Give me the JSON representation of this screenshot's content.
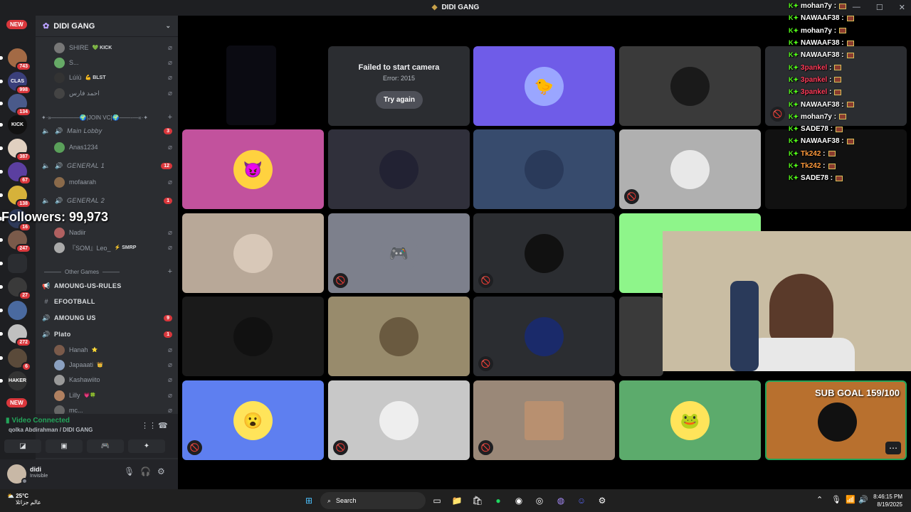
{
  "window": {
    "title": "DIDI GANG"
  },
  "server_rail": {
    "new_top": "NEW",
    "new_bottom": "NEW",
    "servers": [
      {
        "label": "",
        "badge": "743",
        "color": "#a36a45"
      },
      {
        "label": "CLAS",
        "badge": "998",
        "color": "#3a3f7a"
      },
      {
        "label": "",
        "badge": "134",
        "color": "#4a5a8a"
      },
      {
        "label": "KICK",
        "badge": "",
        "color": "#111111"
      },
      {
        "label": "",
        "badge": "387",
        "color": "#e0d0c0"
      },
      {
        "label": "",
        "badge": "67",
        "color": "#5b3fa0"
      },
      {
        "label": "",
        "badge": "138",
        "color": "#d6b23a"
      },
      {
        "label": "",
        "badge": "16",
        "color": "#2e3a5a"
      },
      {
        "label": "",
        "badge": "247",
        "color": "#7a5a4a"
      },
      {
        "label": "",
        "badge": "",
        "color": "#2b2d31"
      },
      {
        "label": "",
        "badge": "27",
        "color": "#3a3a3a"
      },
      {
        "label": "",
        "badge": "",
        "color": "#4a6aa0"
      },
      {
        "label": "",
        "badge": "272",
        "color": "#c0c0c0"
      },
      {
        "label": "",
        "badge": "6",
        "color": "#5a4a3a"
      },
      {
        "label": "HAKER",
        "badge": "",
        "color": "#333333"
      }
    ]
  },
  "sidebar": {
    "server_name": "DIDI GANG",
    "top_users": [
      {
        "name": "SHIRE",
        "tag": "💚 KICK",
        "avatar_color": "#777777"
      },
      {
        "name": "S...",
        "tag": "",
        "avatar_color": "#66aa66"
      },
      {
        "name": "Lúíù",
        "tag": "💪 BLST",
        "avatar_color": "#333333"
      },
      {
        "name": "احمد فارس",
        "tag": "",
        "avatar_color": "#444444"
      }
    ],
    "category_join": "✦·»—————🌍|JOIN VC|🌍——-—«·✦",
    "voice_channels": [
      {
        "name": "Main Lobby",
        "count": "3"
      },
      {
        "name": "GENERAL 1",
        "count": "12"
      },
      {
        "name": "GENERAL 2",
        "count": "1"
      }
    ],
    "users_main_lobby": [
      {
        "name": "Anas1234",
        "avatar_color": "#5aa05a"
      }
    ],
    "users_general_1": [
      {
        "name": "mofaarah",
        "avatar_color": "#8a6a4a"
      }
    ],
    "users_general_2": [
      {
        "name": "Nadiir",
        "avatar_color": "#b06060"
      },
      {
        "name": "『SOM』Leo_",
        "tag": "⚡ SMRP",
        "avatar_color": "#aaaaaa"
      }
    ],
    "category_other": "Other Games",
    "other_channels": [
      {
        "name": "AMOUNG-US-RULES",
        "icon": "📢",
        "count": ""
      },
      {
        "name": "EFOOTBALL",
        "icon": "#",
        "count": ""
      },
      {
        "name": "AMOUNG US",
        "icon": "🔊",
        "count": "9"
      },
      {
        "name": "Plato",
        "icon": "🔊",
        "count": "1"
      }
    ],
    "users_plato": [
      {
        "name": "Hanah",
        "tag": "⭐",
        "avatar_color": "#7a5a4a"
      },
      {
        "name": "Japaaati",
        "tag": "👑",
        "avatar_color": "#8aa0c0"
      },
      {
        "name": "Kashawiito",
        "avatar_color": "#999999"
      },
      {
        "name": "Lilly",
        "tag": "💗🍀",
        "avatar_color": "#b08060"
      },
      {
        "name": "mc...",
        "avatar_color": "#666666"
      }
    ]
  },
  "overlay": {
    "followers": "Followers: 99,973"
  },
  "voice_panel": {
    "status": "Video Connected",
    "location": "qolka Abdirahman / DIDI GANG"
  },
  "user_panel": {
    "username": "didi",
    "status": "Invisible"
  },
  "call": {
    "failed_title": "Failed to start camera",
    "failed_error": "Error: 2015",
    "try_again": "Try again",
    "sub_goal": "SUB GOAL 159/100"
  },
  "chat": [
    {
      "name": "mohan7y",
      "color": "#ffffff"
    },
    {
      "name": "NAWAAF38",
      "color": "#ffffff"
    },
    {
      "name": "mohan7y",
      "color": "#ffffff"
    },
    {
      "name": "NAWAAF38",
      "color": "#ffffff"
    },
    {
      "name": "NAWAAF38",
      "color": "#ffffff"
    },
    {
      "name": "3pankel",
      "color": "#ff3c5a"
    },
    {
      "name": "3pankel",
      "color": "#ff3c5a"
    },
    {
      "name": "3pankel",
      "color": "#ff3c5a"
    },
    {
      "name": "NAWAAF38",
      "color": "#ffffff"
    },
    {
      "name": "mohan7y",
      "color": "#ffffff"
    },
    {
      "name": "SADE78",
      "color": "#ffffff"
    },
    {
      "name": "NAWAAF38",
      "color": "#ffffff"
    },
    {
      "name": "Tk242",
      "color": "#ff9a3c"
    },
    {
      "name": "Tk242",
      "color": "#ff9a3c"
    },
    {
      "name": "SADE78",
      "color": "#ffffff"
    }
  ],
  "taskbar": {
    "weather_temp": "25°C",
    "weather_text": "عالم جزائلا",
    "search": "Search",
    "time": "8:46:15 PM",
    "date": "8/19/2025"
  }
}
